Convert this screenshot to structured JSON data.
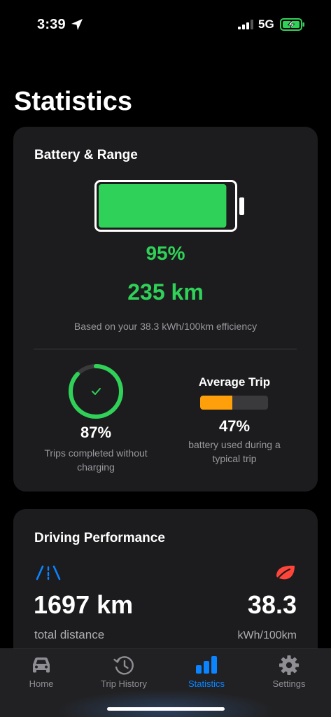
{
  "status_bar": {
    "time": "3:39",
    "network": "5G"
  },
  "page": {
    "title": "Statistics"
  },
  "battery_card": {
    "title": "Battery & Range",
    "charge_percent": 95,
    "charge_label": "95%",
    "range_label": "235 km",
    "efficiency_note": "Based on your 38.3 kWh/100km efficiency",
    "trips": {
      "percent": 87,
      "percent_label": "87%",
      "description": "Trips completed without charging"
    },
    "average_trip": {
      "title": "Average Trip",
      "percent": 47,
      "percent_label": "47%",
      "description": "battery used during a typical trip"
    }
  },
  "driving_card": {
    "title": "Driving Performance",
    "distance_value": "1697 km",
    "distance_label": "total distance",
    "efficiency_value": "38.3",
    "efficiency_label": "kWh/100km",
    "icons": {
      "left": "road-icon",
      "right": "leaf-icon"
    }
  },
  "tab_bar": {
    "active": "statistics",
    "tabs": [
      {
        "id": "home",
        "label": "Home",
        "icon": "car-icon"
      },
      {
        "id": "trip-history",
        "label": "Trip History",
        "icon": "history-icon"
      },
      {
        "id": "statistics",
        "label": "Statistics",
        "icon": "bar-chart-icon"
      },
      {
        "id": "settings",
        "label": "Settings",
        "icon": "gear-icon"
      }
    ]
  },
  "colors": {
    "accent_green": "#30d158",
    "accent_orange": "#ff9f0a",
    "accent_blue": "#0a84ff",
    "leaf_red": "#ff453a",
    "card_bg": "#1c1c1e"
  }
}
